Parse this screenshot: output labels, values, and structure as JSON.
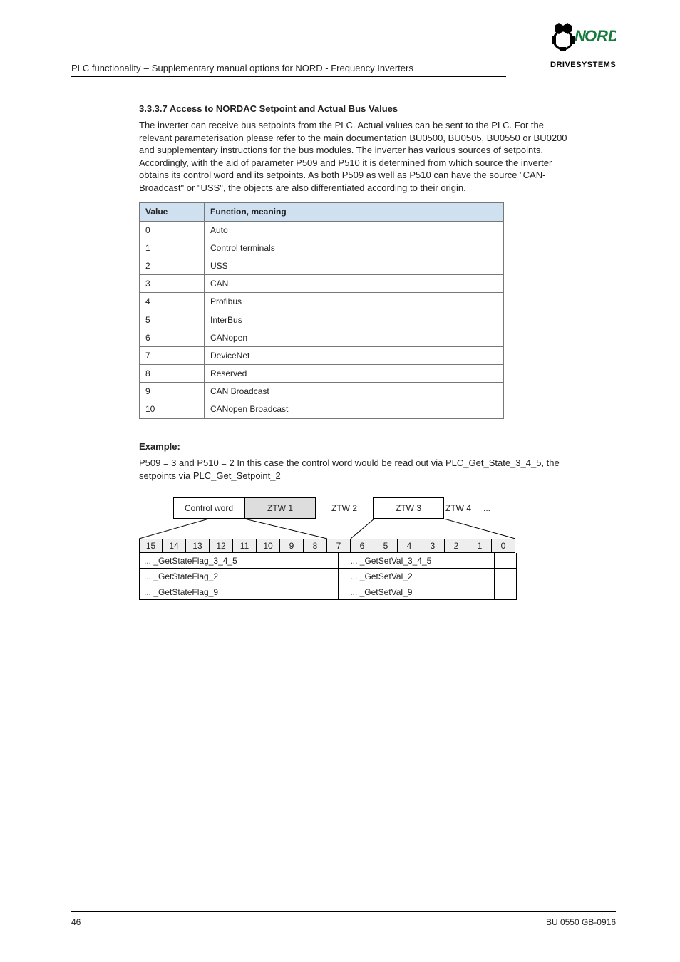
{
  "header": {
    "doc": "PLC functionality",
    "sep": "–",
    "sub": "Supplementary manual options for NORD - Frequency Inverters"
  },
  "logo": {
    "brand": "NORD",
    "sub": "DRIVESYSTEMS"
  },
  "section_title": "3.3.3.7 Access to NORDAC Setpoint and Actual Bus Values",
  "intro": "The inverter can receive bus setpoints from the PLC. Actual values can be sent to the PLC. For the relevant parameterisation please refer to the main documentation BU0500, BU0505, BU0550 or BU0200 and supplementary instructions for the bus modules. The inverter has various sources of setpoints. Accordingly, with the aid of parameter P509 and P510 it is determined from which source the inverter obtains its control word and its setpoints. As both P509 as well as P510 can have the source \"CAN-Broadcast\" or \"USS\", the objects are also differentiated according to their origin.",
  "table": {
    "hdr": [
      "Value",
      "Function, meaning"
    ],
    "rows": [
      [
        "0",
        "Auto"
      ],
      [
        "1",
        "Control terminals"
      ],
      [
        "2",
        "USS"
      ],
      [
        "3",
        "CAN"
      ],
      [
        "4",
        "Profibus"
      ],
      [
        "5",
        "InterBus"
      ],
      [
        "6",
        "CANopen"
      ],
      [
        "7",
        "DeviceNet"
      ],
      [
        "8",
        "Reserved"
      ],
      [
        "9",
        "CAN Broadcast"
      ],
      [
        "10",
        "CANopen Broadcast"
      ]
    ]
  },
  "example_hdr": "Example:",
  "example_body": "P509 = 3 and P510 = 2 In this case the control word would be read out via PLC_Get_State_3_4_5, the setpoints via PLC_Get_Setpoint_2",
  "diagram": {
    "top": [
      "Control word",
      "ZTW 1",
      "ZTW 2",
      "ZTW 3",
      "ZTW 4",
      "..."
    ],
    "bits": [
      "15",
      "14",
      "13",
      "12",
      "11",
      "10",
      "9",
      "8",
      "7",
      "6",
      "5",
      "4",
      "3",
      "2",
      "1",
      "0"
    ],
    "rows": [
      [
        {
          "t": "... _GetStateFlag_3_4_5",
          "w": "w6"
        },
        {
          "t": "",
          "w": "w2"
        },
        {
          "t": "",
          "w": "w1"
        },
        {
          "t": "... _GetSetVal_3_4_5",
          "w": "w7"
        },
        {
          "t": "",
          "w": "w1"
        }
      ],
      [
        {
          "t": "... _GetStateFlag_2",
          "w": "w6"
        },
        {
          "t": "",
          "w": "w2"
        },
        {
          "t": "",
          "w": "w1"
        },
        {
          "t": "... _GetSetVal_2",
          "w": "w7"
        },
        {
          "t": "",
          "w": "w1"
        }
      ],
      [
        {
          "t": "... _GetStateFlag_9",
          "w": "w8"
        },
        {
          "t": "",
          "w": "w1"
        },
        {
          "t": "... _GetSetVal_9",
          "w": "w7"
        },
        {
          "t": "",
          "w": "w1"
        }
      ]
    ]
  },
  "footer": {
    "left": "46",
    "right": "BU 0550 GB-0916"
  }
}
